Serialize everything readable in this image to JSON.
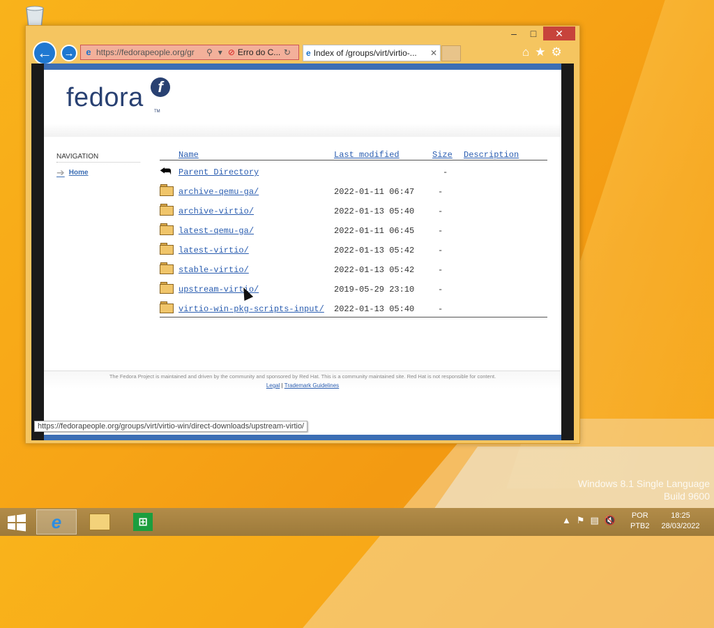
{
  "browser": {
    "address_url": "https://fedorapeople.org/gr",
    "address_error_tab": "Erro do C...",
    "tab_title": "Index of /groups/virt/virtio-..."
  },
  "page": {
    "logo_text": "fedora",
    "logo_tm": "TM",
    "navigation_header": "NAVIGATION",
    "navigation_home": "Home",
    "columns": {
      "name": "Name",
      "last_modified": "Last modified",
      "size": "Size",
      "description": "Description"
    },
    "parent_directory": {
      "name": "Parent Directory",
      "size": "-"
    },
    "entries": [
      {
        "name": "archive-qemu-ga/",
        "modified": "2022-01-11 06:47",
        "size": "-"
      },
      {
        "name": "archive-virtio/",
        "modified": "2022-01-13 05:40",
        "size": "-"
      },
      {
        "name": "latest-qemu-ga/",
        "modified": "2022-01-11 06:45",
        "size": "-"
      },
      {
        "name": "latest-virtio/",
        "modified": "2022-01-13 05:42",
        "size": "-"
      },
      {
        "name": "stable-virtio/",
        "modified": "2022-01-13 05:42",
        "size": "-"
      },
      {
        "name": "upstream-virtio/",
        "modified": "2019-05-29 23:10",
        "size": "-"
      },
      {
        "name": "virtio-win-pkg-scripts-input/",
        "modified": "2022-01-13 05:40",
        "size": "-"
      }
    ],
    "footer_text": "The Fedora Project is maintained and driven by the community and sponsored by Red Hat. This is a community maintained site. Red Hat is not responsible for content.",
    "footer_links": {
      "legal": "Legal",
      "separator": "|",
      "trademark": "Trademark Guidelines"
    }
  },
  "status_bar_url": "https://fedorapeople.org/groups/virt/virtio-win/direct-downloads/upstream-virtio/",
  "watermark": {
    "line1": "Windows 8.1 Single Language",
    "line2": "Build 9600"
  },
  "taskbar": {
    "lang_line1": "POR",
    "lang_line2": "PTB2",
    "time": "18:25",
    "date": "28/03/2022"
  }
}
